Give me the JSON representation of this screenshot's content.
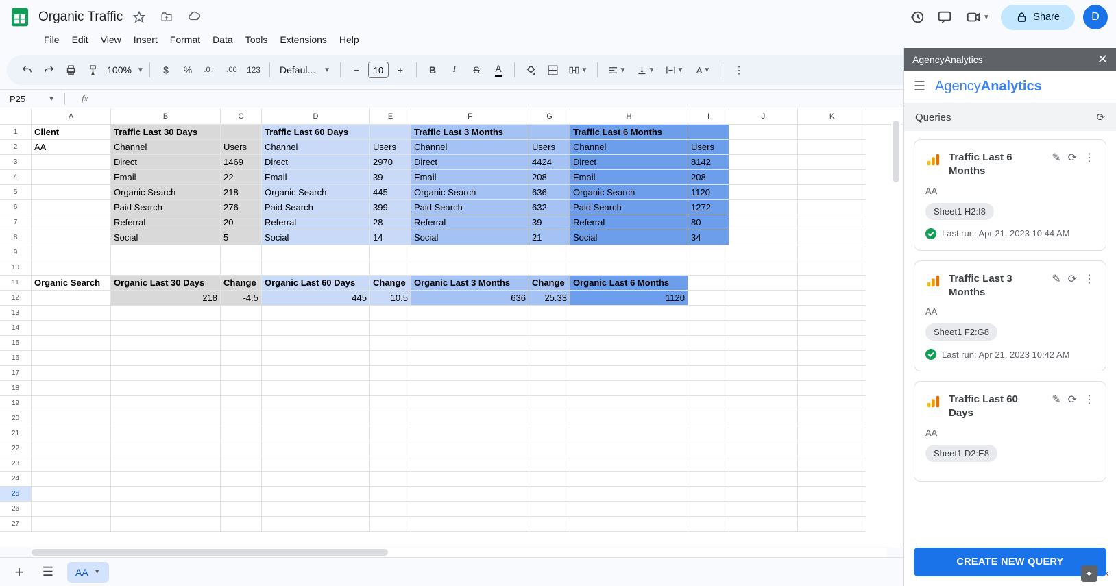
{
  "doc": {
    "title": "Organic Traffic"
  },
  "menus": [
    "File",
    "Edit",
    "View",
    "Insert",
    "Format",
    "Data",
    "Tools",
    "Extensions",
    "Help"
  ],
  "toolbar": {
    "zoom": "100%",
    "font": "Defaul...",
    "fsize": "10",
    "numfmt": "123"
  },
  "share_label": "Share",
  "avatar_initial": "D",
  "name_box": "P25",
  "cols": [
    "A",
    "B",
    "C",
    "D",
    "E",
    "F",
    "G",
    "H",
    "I",
    "J",
    "K"
  ],
  "headers_row1": {
    "A": "Client",
    "B": "Traffic Last 30 Days",
    "D": "Traffic Last 60 Days",
    "F": "Traffic Last 3 Months",
    "H": "Traffic Last 6 Months"
  },
  "row2": {
    "A": "AA",
    "B": "Channel",
    "C": "Users",
    "D": "Channel",
    "E": "Users",
    "F": "Channel",
    "G": "Users",
    "H": "Channel",
    "I": "Users"
  },
  "traffic_rows": [
    {
      "B": "Direct",
      "C": "1469",
      "D": "Direct",
      "E": "2970",
      "F": "Direct",
      "G": "4424",
      "H": "Direct",
      "I": "8142"
    },
    {
      "B": "Email",
      "C": "22",
      "D": "Email",
      "E": "39",
      "F": "Email",
      "G": "208",
      "H": "Email",
      "I": "208"
    },
    {
      "B": "Organic Search",
      "C": "218",
      "D": "Organic Search",
      "E": "445",
      "F": "Organic Search",
      "G": "636",
      "H": "Organic Search",
      "I": "1120"
    },
    {
      "B": "Paid Search",
      "C": "276",
      "D": "Paid Search",
      "E": "399",
      "F": "Paid Search",
      "G": "632",
      "H": "Paid Search",
      "I": "1272"
    },
    {
      "B": "Referral",
      "C": "20",
      "D": "Referral",
      "E": "28",
      "F": "Referral",
      "G": "39",
      "H": "Referral",
      "I": "80"
    },
    {
      "B": "Social",
      "C": "5",
      "D": "Social",
      "E": "14",
      "F": "Social",
      "G": "21",
      "H": "Social",
      "I": "34"
    }
  ],
  "row11": {
    "A": "Organic Search",
    "B": "Organic Last 30 Days",
    "C": "Change",
    "D": "Organic Last 60 Days",
    "E": "Change",
    "F": "Organic Last 3 Months",
    "G": "Change",
    "H": "Organic Last 6 Months"
  },
  "row12": {
    "B": "218",
    "C": "-4.5",
    "D": "445",
    "E": "10.5",
    "F": "636",
    "G": "25.33",
    "H": "1120"
  },
  "panel": {
    "title": "AgencyAnalytics",
    "queries_label": "Queries",
    "cards": [
      {
        "title": "Traffic Last 6 Months",
        "sub": "AA",
        "chip": "Sheet1 H2:I8",
        "lastrun": "Last run: Apr 21, 2023 10:44 AM"
      },
      {
        "title": "Traffic Last 3 Months",
        "sub": "AA",
        "chip": "Sheet1 F2:G8",
        "lastrun": "Last run: Apr 21, 2023 10:42 AM"
      },
      {
        "title": "Traffic Last 60 Days",
        "sub": "AA",
        "chip": "Sheet1 D2:E8",
        "lastrun": ""
      }
    ],
    "create_label": "CREATE NEW QUERY"
  },
  "sheet_tab": "AA"
}
